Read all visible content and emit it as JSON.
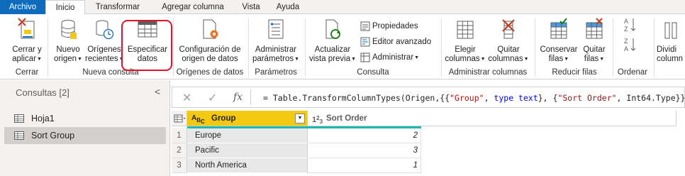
{
  "tabs": {
    "file": "Archivo",
    "home": "Inicio",
    "transform": "Transformar",
    "add_column": "Agregar columna",
    "view": "Vista",
    "help": "Ayuda"
  },
  "ribbon": {
    "close_apply": {
      "line1": "Cerrar y",
      "line2": "aplicar"
    },
    "new_source": {
      "line1": "Nuevo",
      "line2": "origen"
    },
    "recent_sources": {
      "line1": "Orígenes",
      "line2": "recientes"
    },
    "enter_data": {
      "line1": "Especificar",
      "line2": "datos"
    },
    "data_source_settings": {
      "line1": "Configuración de",
      "line2": "origen de datos"
    },
    "manage_params": {
      "line1": "Administrar",
      "line2": "parámetros"
    },
    "refresh_preview": {
      "line1": "Actualizar",
      "line2": "vista previa"
    },
    "properties": "Propiedades",
    "advanced_editor": "Editor avanzado",
    "manage": "Administrar",
    "choose_columns": {
      "line1": "Elegir",
      "line2": "columnas"
    },
    "remove_columns": {
      "line1": "Quitar",
      "line2": "columnas"
    },
    "keep_rows": {
      "line1": "Conservar",
      "line2": "filas"
    },
    "remove_rows": {
      "line1": "Quitar",
      "line2": "filas"
    },
    "split_column": {
      "line1": "Dividi",
      "line2": "column"
    },
    "groups": {
      "close": "Cerrar",
      "new_query": "Nueva consulta",
      "data_sources": "Orígenes de datos",
      "parameters": "Parámetros",
      "query": "Consulta",
      "manage_columns": "Administrar columnas",
      "reduce_rows": "Reducir filas",
      "sort": "Ordenar"
    }
  },
  "queries_pane": {
    "title": "Consultas [2]",
    "items": [
      {
        "label": "Hoja1"
      },
      {
        "label": "Sort Group"
      }
    ]
  },
  "formula_bar": {
    "prefix": "= Table.TransformColumnTypes(Origen,{{",
    "s1": "\"Group\"",
    "mid1": ", ",
    "k1": "type text",
    "mid2": "}, {",
    "s2": "\"Sort Order\"",
    "mid3": ", Int64.Type}})"
  },
  "grid": {
    "columns": [
      {
        "type_icon": "ABC",
        "name": "Group"
      },
      {
        "type_icon": "123",
        "name": "Sort Order"
      }
    ],
    "rows": [
      {
        "n": "1",
        "group": "Europe",
        "sort": "2"
      },
      {
        "n": "2",
        "group": "Pacific",
        "sort": "3"
      },
      {
        "n": "3",
        "group": "North America",
        "sort": "1"
      }
    ]
  },
  "colors": {
    "file_tab": "#0f6cbd",
    "selected_column": "#f2c811",
    "quality_bar": "#1eb8b0",
    "highlight_ring": "#e3112a"
  }
}
